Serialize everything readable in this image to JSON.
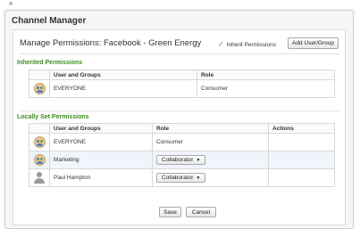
{
  "app": {
    "title": "Channel Manager"
  },
  "header": {
    "title": "Manage Permissions: Facebook - Green Energy",
    "inherit_label": "Inherit Permissions",
    "add_button": "Add User/Group"
  },
  "inherited": {
    "title": "Inherited Permissions",
    "columns": [
      "User and Groups",
      "Role"
    ],
    "rows": [
      {
        "icon": "group-icon",
        "name": "EVERYONE",
        "role": "Consumer"
      }
    ]
  },
  "local": {
    "title": "Locally Set Permissions",
    "columns": [
      "User and Groups",
      "Role",
      "Actions"
    ],
    "rows": [
      {
        "icon": "group-icon",
        "name": "EVERYONE",
        "role": "Consumer"
      },
      {
        "icon": "group-icon",
        "name": "Marketing",
        "role": "Collaborator"
      },
      {
        "icon": "user-icon",
        "name": "Paul Hampton",
        "role": "Collaborator"
      }
    ]
  },
  "footer": {
    "save": "Save",
    "cancel": "Cancel"
  },
  "colors": {
    "section_title": "#3b8d1e",
    "check": "#3aa33a",
    "highlight_row": "#f0f4fb"
  }
}
